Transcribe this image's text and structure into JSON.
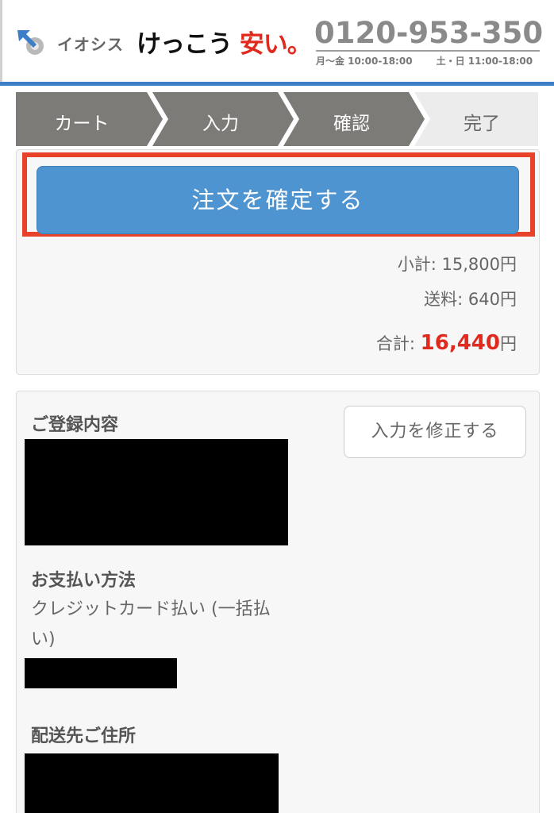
{
  "header": {
    "brand_small": "イオシス",
    "brand_main": "けっこう",
    "brand_accent": "安い。",
    "phone": "0120-953-350",
    "hours_weekday": "月〜金 10:00-18:00",
    "hours_weekend": "土・日 11:00-18:00",
    "colors": {
      "accent_blue": "#3c7ec8",
      "accent_red": "#e02a1e"
    }
  },
  "steps": [
    {
      "label": "カート",
      "state": "done"
    },
    {
      "label": "入力",
      "state": "done"
    },
    {
      "label": "確認",
      "state": "active"
    },
    {
      "label": "完了",
      "state": "pending"
    }
  ],
  "order": {
    "confirm_label": "注文を確定する",
    "subtotal_label": "小計: ",
    "subtotal_value": "15,800円",
    "shipping_label": "送料: ",
    "shipping_value": "640円",
    "total_label": "合計: ",
    "total_value": "16,440",
    "total_unit": "円"
  },
  "details": {
    "edit_label": "入力を修正する",
    "registration_title": "ご登録内容",
    "payment_title": "お支払い方法",
    "payment_text": "クレジットカード払い (一括払い)",
    "shipping_title": "配送先ご住所"
  }
}
